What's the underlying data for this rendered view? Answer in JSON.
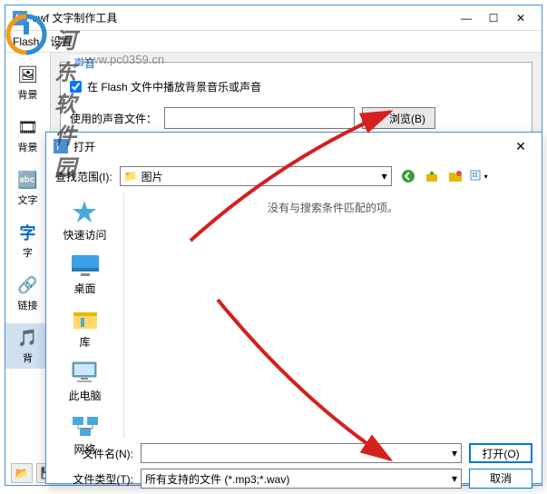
{
  "main": {
    "title": "swf 文字制作工具",
    "menu": {
      "flash": "Flash",
      "settings": "设置"
    },
    "sidebar": [
      {
        "label": "背景",
        "icon": "🖼"
      },
      {
        "label": "背景",
        "icon": "🎞"
      },
      {
        "label": "文字",
        "icon": "🔤"
      },
      {
        "label": "字",
        "icon": "字"
      },
      {
        "label": "链接",
        "icon": "🔗"
      },
      {
        "label": "背",
        "icon": "🎵"
      }
    ],
    "group_title": "声音",
    "checkbox_label": "在 Flash 文件中播放背景音乐或声音",
    "sound_file_label": "使用的声音文件：",
    "browse": "浏览(B)"
  },
  "open": {
    "title": "打开",
    "look_in_label": "查找范围(I):",
    "look_in_value": "图片",
    "empty_text": "没有与搜索条件匹配的项。",
    "places": [
      {
        "label": "快速访问",
        "icon": "star"
      },
      {
        "label": "桌面",
        "icon": "desktop"
      },
      {
        "label": "库",
        "icon": "lib"
      },
      {
        "label": "此电脑",
        "icon": "pc"
      },
      {
        "label": "网络",
        "icon": "net"
      }
    ],
    "filename_label": "文件名(N):",
    "filetype_label": "文件类型(T):",
    "filetype_value": "所有支持的文件 (*.mp3;*.wav)",
    "open_btn": "打开(O)",
    "cancel_btn": "取消"
  },
  "watermark": {
    "text": "河东软件园",
    "url": "www.pc0359.cn"
  }
}
